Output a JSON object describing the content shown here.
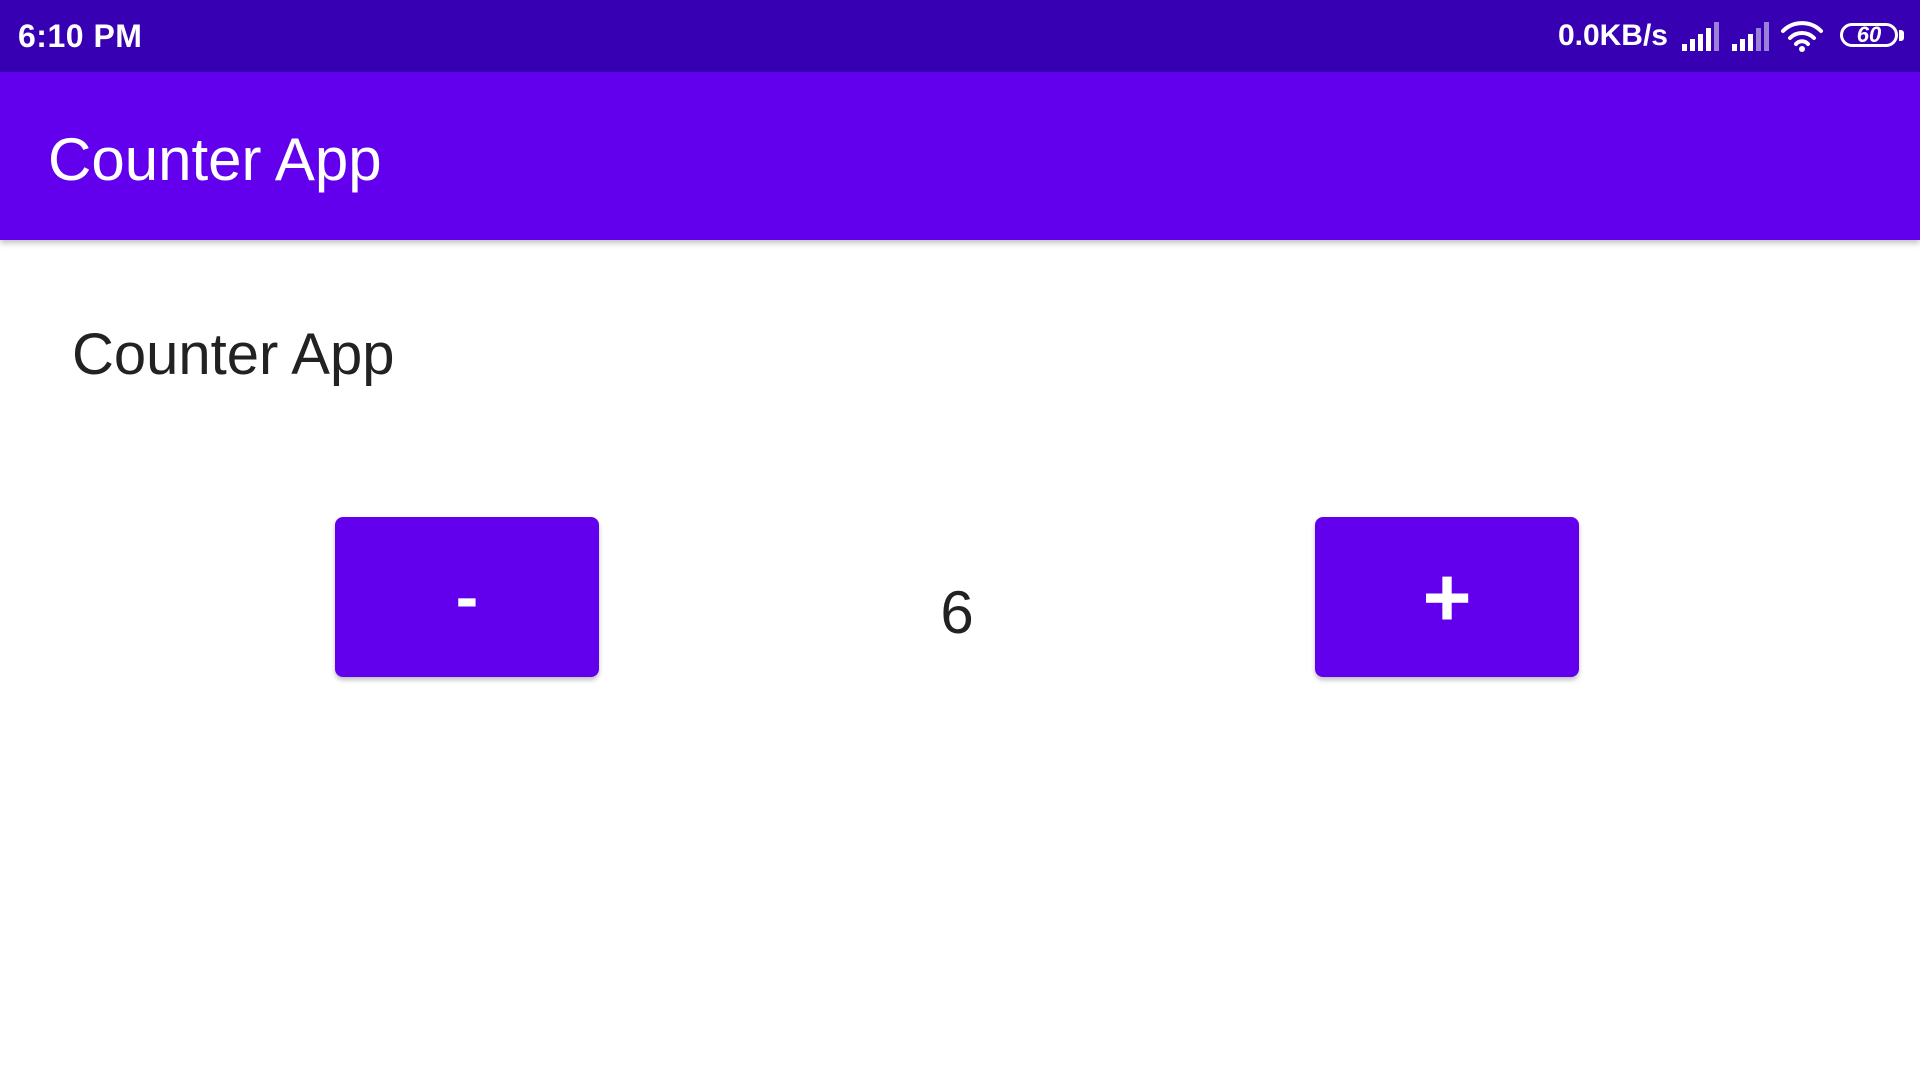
{
  "status_bar": {
    "time": "6:10 PM",
    "net_speed": "0.0KB/s",
    "battery_level": "60",
    "background_color": "#3700b3",
    "icons": [
      "signal-strength-icon",
      "signal-strength-icon",
      "wifi-icon",
      "battery-icon"
    ]
  },
  "app_bar": {
    "title": "Counter App",
    "background_color": "#6200ee"
  },
  "main": {
    "heading": "Counter App",
    "decrement_label": "-",
    "increment_label": "+",
    "counter_value": "6",
    "button_color": "#6200ee"
  }
}
